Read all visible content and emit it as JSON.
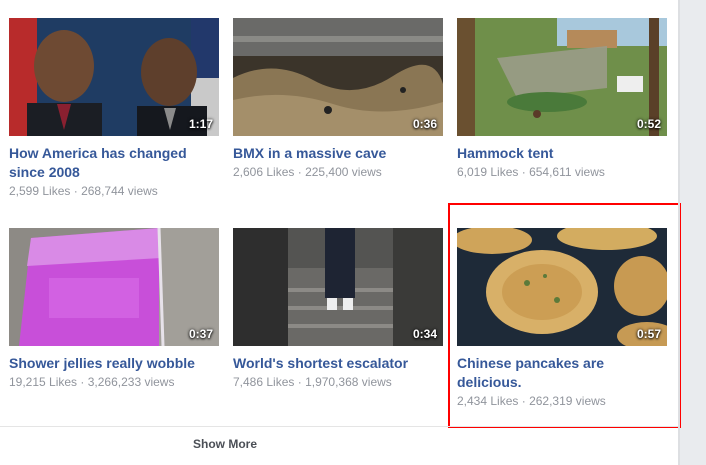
{
  "videos": [
    {
      "title": "How America has changed since 2008",
      "likes": "2,599 Likes",
      "views": "268,744 views",
      "duration": "1:17"
    },
    {
      "title": "BMX in a massive cave",
      "likes": "2,606 Likes",
      "views": "225,400 views",
      "duration": "0:36"
    },
    {
      "title": "Hammock tent",
      "likes": "6,019 Likes",
      "views": "654,611 views",
      "duration": "0:52"
    },
    {
      "title": "Shower jellies really wobble",
      "likes": "19,215 Likes",
      "views": "3,266,233 views",
      "duration": "0:37"
    },
    {
      "title": "World's shortest escalator",
      "likes": "7,486 Likes",
      "views": "1,970,368 views",
      "duration": "0:34"
    },
    {
      "title": "Chinese pancakes are delicious.",
      "likes": "2,434 Likes",
      "views": "262,319 views",
      "duration": "0:57"
    }
  ],
  "stats_separator": " · ",
  "show_more_label": "Show More",
  "colors": {
    "link": "#365899",
    "meta": "#90949c",
    "highlight": "#ff0000"
  }
}
